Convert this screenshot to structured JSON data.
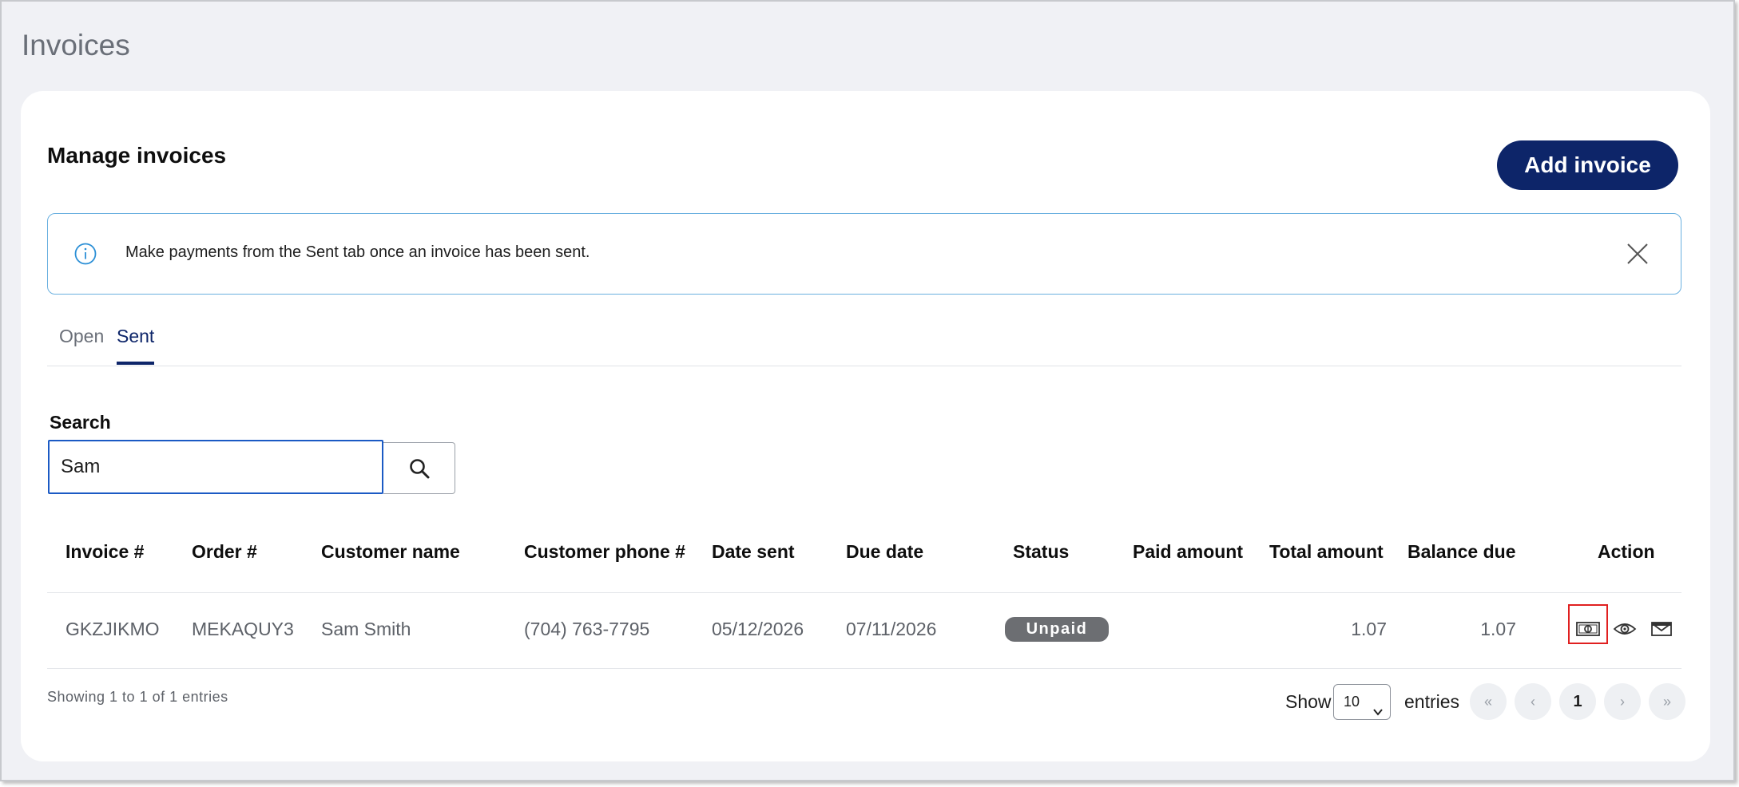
{
  "page": {
    "title": "Invoices"
  },
  "card": {
    "title": "Manage invoices",
    "add_button_label": "Add invoice"
  },
  "alert": {
    "message": "Make payments from the Sent tab once an invoice has been sent.",
    "icon": "info-icon",
    "close_icon": "close-icon"
  },
  "tabs": [
    {
      "label": "Open",
      "active": false
    },
    {
      "label": "Sent",
      "active": true
    }
  ],
  "search": {
    "label": "Search",
    "value": "Sam",
    "button_icon": "search-icon"
  },
  "table": {
    "columns": [
      "Invoice #",
      "Order #",
      "Customer name",
      "Customer phone #",
      "Date sent",
      "Due date",
      "Status",
      "Paid amount",
      "Total amount",
      "Balance due",
      "Action"
    ],
    "rows": [
      {
        "invoice": "GKZJIKMO",
        "order": "MEKAQUY3",
        "customer_name": "Sam Smith",
        "customer_phone": "(704) 763-7795",
        "date_sent": "05/12/2026",
        "due_date": "07/11/2026",
        "status": "Unpaid",
        "paid_amount": "",
        "total_amount": "1.07",
        "balance_due": "1.07",
        "actions": [
          "make-payment-icon",
          "view-icon",
          "email-icon"
        ]
      }
    ]
  },
  "footer": {
    "showing_text": "Showing 1 to 1 of 1 entries",
    "show_label": "Show",
    "entries_value": "10",
    "entries_label": "entries",
    "pagination": {
      "first": "«",
      "prev": "‹",
      "current": "1",
      "next": "›",
      "last": "»"
    }
  },
  "colors": {
    "primary": "#0d2569",
    "alert_border": "#6ab0e0",
    "status_badge": "#6c6e72",
    "highlight": "#e02020",
    "background": "#f0f1f5"
  }
}
